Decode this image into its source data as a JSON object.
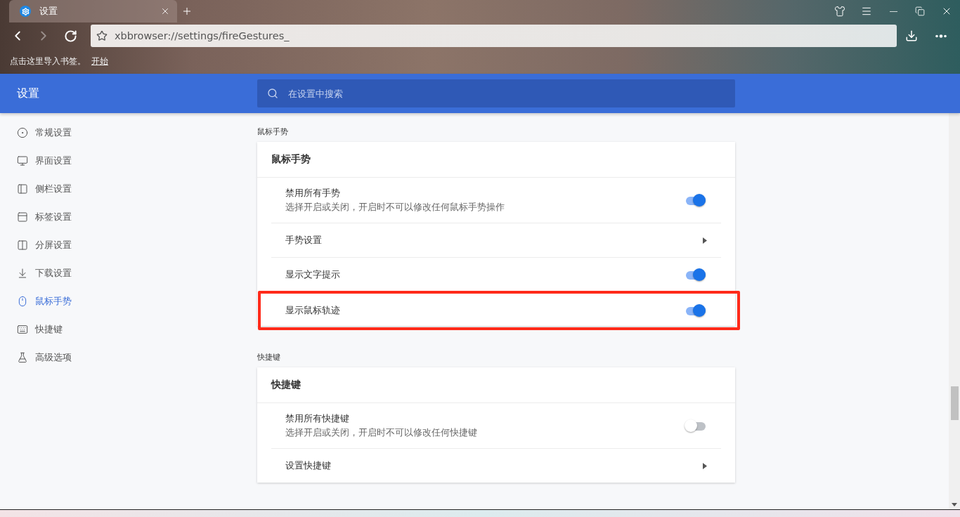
{
  "tab": {
    "title": "设置",
    "selected": true
  },
  "address_bar": {
    "value": "xbbrowser://settings/fireGestures_"
  },
  "bookmark_bar": {
    "text": "点击这里导入书签。",
    "link": "开始"
  },
  "header": {
    "title": "设置",
    "search": {
      "placeholder": "在设置中搜索"
    }
  },
  "sidebar": {
    "items": [
      {
        "label": "常规设置",
        "selected": false
      },
      {
        "label": "界面设置",
        "selected": false
      },
      {
        "label": "侧栏设置",
        "selected": false
      },
      {
        "label": "标签设置",
        "selected": false
      },
      {
        "label": "分屏设置",
        "selected": false
      },
      {
        "label": "下载设置",
        "selected": false
      },
      {
        "label": "鼠标手势",
        "selected": true
      },
      {
        "label": "快捷键",
        "selected": false
      },
      {
        "label": "高级选项",
        "selected": false
      }
    ]
  },
  "sections": [
    {
      "label": "鼠标手势",
      "card_title": "鼠标手势",
      "rows": [
        {
          "kind": "toggle",
          "title": "禁用所有手势",
          "description": "选择开启或关闭，开启时不可以修改任何鼠标手势操作",
          "on": true,
          "highlighted": false
        },
        {
          "kind": "link",
          "title": "手势设置",
          "highlighted": false
        },
        {
          "kind": "toggle",
          "title": "显示文字提示",
          "on": true,
          "highlighted": false
        },
        {
          "kind": "toggle",
          "title": "显示鼠标轨迹",
          "on": true,
          "highlighted": true
        }
      ]
    },
    {
      "label": "快捷键",
      "card_title": "快捷键",
      "rows": [
        {
          "kind": "toggle",
          "title": "禁用所有快捷键",
          "description": "选择开启或关闭，开启时不可以修改任何快捷键",
          "on": false,
          "highlighted": false
        },
        {
          "kind": "link",
          "title": "设置快捷键",
          "highlighted": false
        }
      ]
    }
  ]
}
